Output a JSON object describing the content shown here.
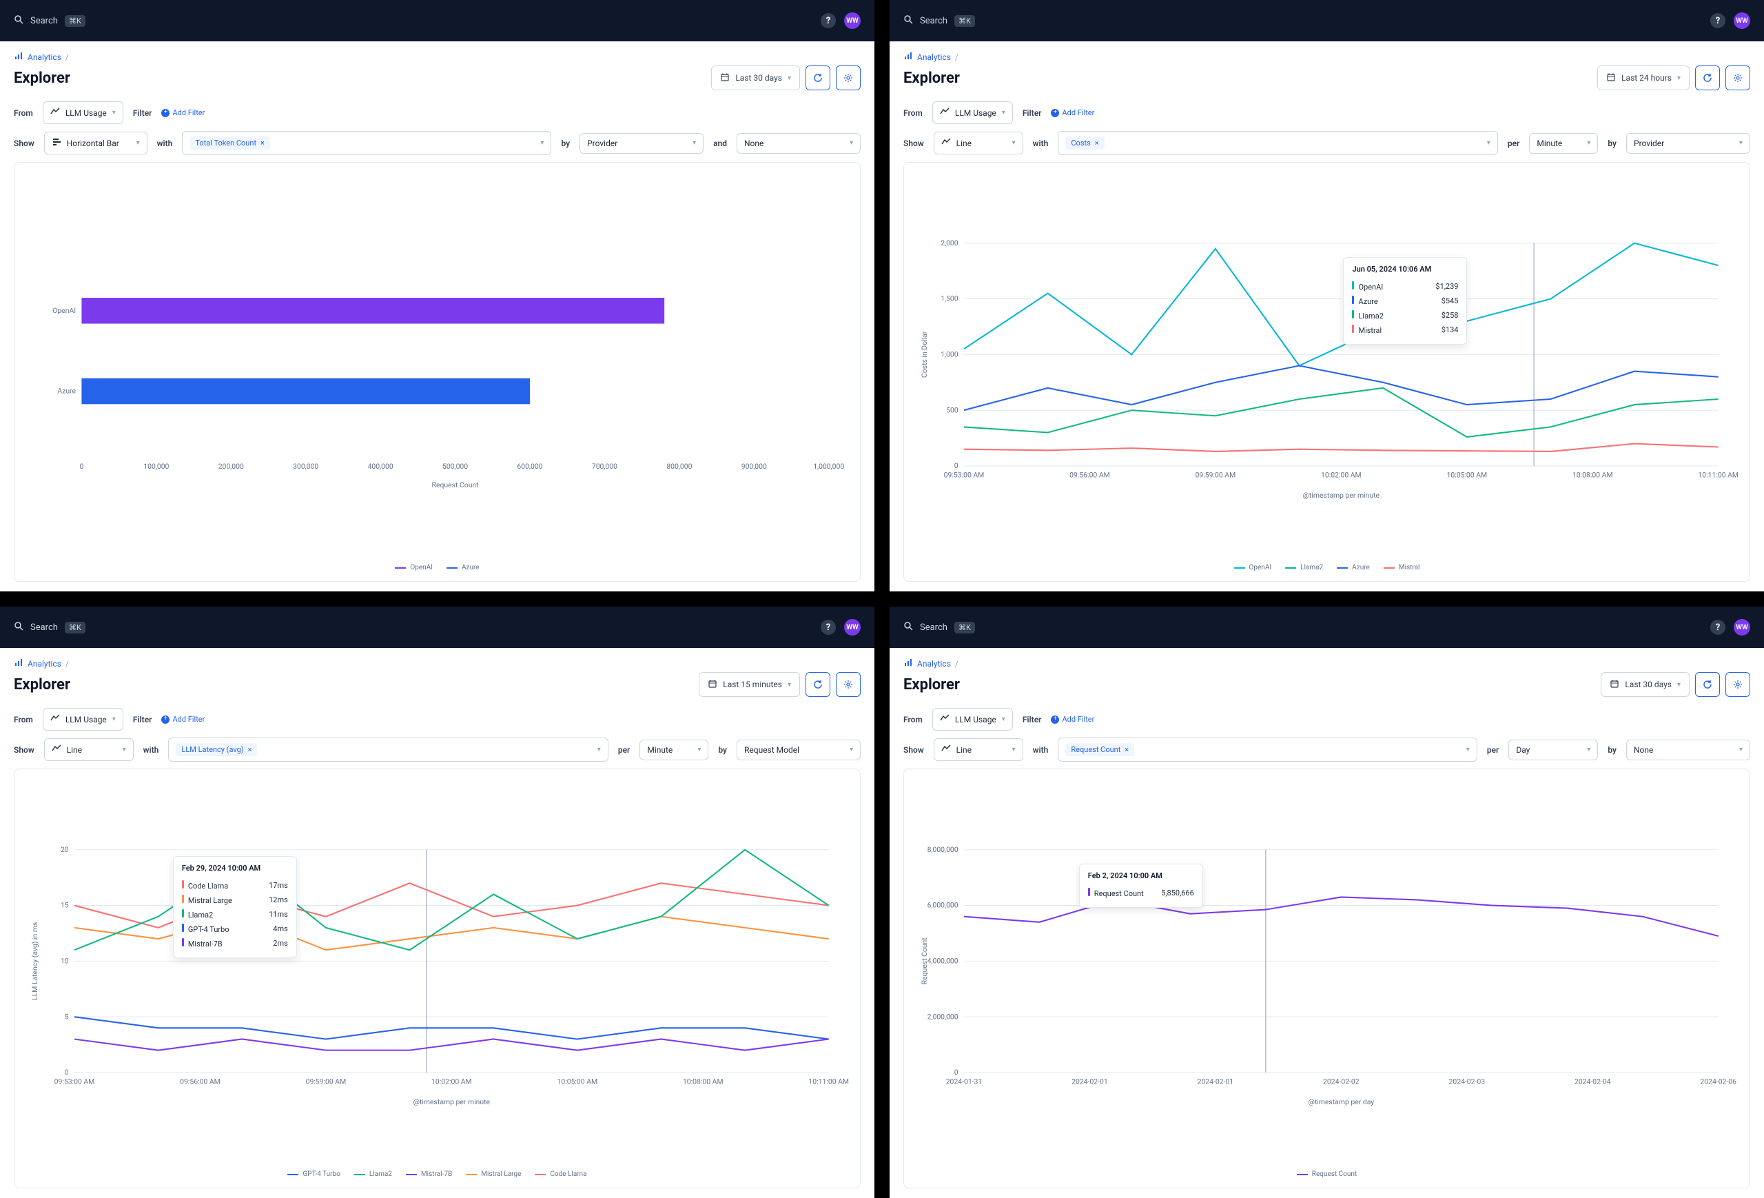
{
  "common": {
    "searchLabel": "Search",
    "searchKbd": "⌘K",
    "avatarInitials": "WW",
    "breadcrumb": "Analytics",
    "pageTitle": "Explorer",
    "fromLabel": "From",
    "filterLabel": "Filter",
    "addFilter": "Add Filter",
    "showLabel": "Show",
    "withLabel": "with",
    "perLabel": "per",
    "byLabel": "by",
    "andLabel": "and",
    "llmUsage": "LLM Usage"
  },
  "panelA": {
    "timeRange": "Last 30 days",
    "chartType": "Horizontal Bar",
    "metric": "Total Token Count",
    "bySelect": "Provider",
    "andSelect": "None",
    "xAxisLabel": "Request Count",
    "legend": [
      {
        "name": "OpenAI",
        "color": "#7c3aed"
      },
      {
        "name": "Azure",
        "color": "#2563eb"
      }
    ]
  },
  "panelB": {
    "timeRange": "Last 24 hours",
    "chartType": "Line",
    "metric": "Costs",
    "perSelect": "Minute",
    "bySelect": "Provider",
    "yAxisLabel": "Costs in Dollar",
    "xAxisLabel": "@timestamp per minute",
    "tooltip": {
      "title": "Jun 05, 2024 10:06 AM",
      "rows": [
        {
          "name": "OpenAI",
          "value": "$1,239",
          "color": "#06b6d4"
        },
        {
          "name": "Azure",
          "value": "$545",
          "color": "#2563eb"
        },
        {
          "name": "Llama2",
          "value": "$258",
          "color": "#10b981"
        },
        {
          "name": "Mistral",
          "value": "$134",
          "color": "#f87171"
        }
      ]
    },
    "legend": [
      {
        "name": "OpenAI",
        "color": "#06b6d4"
      },
      {
        "name": "Llama2",
        "color": "#10b981"
      },
      {
        "name": "Azure",
        "color": "#2563eb"
      },
      {
        "name": "Mistral",
        "color": "#f87171"
      }
    ]
  },
  "panelC": {
    "timeRange": "Last 15 minutes",
    "chartType": "Line",
    "metric": "LLM Latency (avg)",
    "perSelect": "Minute",
    "bySelect": "Request Model",
    "yAxisLabel": "LLM Latency (avg) in ms",
    "xAxisLabel": "@timestamp per minute",
    "tooltip": {
      "title": "Feb 29, 2024 10:00 AM",
      "rows": [
        {
          "name": "Code Llama",
          "value": "17ms",
          "color": "#f87171"
        },
        {
          "name": "Mistral Large",
          "value": "12ms",
          "color": "#fb923c"
        },
        {
          "name": "Llama2",
          "value": "11ms",
          "color": "#10b981"
        },
        {
          "name": "GPT-4 Turbo",
          "value": "4ms",
          "color": "#2563eb"
        },
        {
          "name": "Mistral-7B",
          "value": "2ms",
          "color": "#7c3aed"
        }
      ]
    },
    "legend": [
      {
        "name": "GPT-4 Turbo",
        "color": "#2563eb"
      },
      {
        "name": "Llama2",
        "color": "#10b981"
      },
      {
        "name": "Mistral-7B",
        "color": "#7c3aed"
      },
      {
        "name": "Mistral Large",
        "color": "#fb923c"
      },
      {
        "name": "Code Llama",
        "color": "#f87171"
      }
    ]
  },
  "panelD": {
    "timeRange": "Last 30 days",
    "chartType": "Line",
    "metric": "Request Count",
    "perSelect": "Day",
    "bySelect": "None",
    "yAxisLabel": "Request Count",
    "xAxisLabel": "@timestamp per day",
    "tooltip": {
      "title": "Feb 2, 2024 10:00 AM",
      "rows": [
        {
          "name": "Request Count",
          "value": "5,850,666",
          "color": "#7c3aed"
        }
      ]
    },
    "legend": [
      {
        "name": "Request Count",
        "color": "#7c3aed"
      }
    ]
  },
  "chart_data": [
    {
      "id": "panelA",
      "type": "bar",
      "orientation": "horizontal",
      "categories": [
        "OpenAI",
        "Azure"
      ],
      "values": [
        780000,
        600000
      ],
      "colors": [
        "#7c3aed",
        "#2563eb"
      ],
      "xlabel": "Request Count",
      "xlim": [
        0,
        1000000
      ],
      "xticks": [
        0,
        100000,
        200000,
        300000,
        400000,
        500000,
        600000,
        700000,
        800000,
        900000,
        1000000
      ]
    },
    {
      "id": "panelB",
      "type": "line",
      "title": "Costs in Dollar per minute",
      "ylabel": "Costs in Dollar",
      "xlabel": "@timestamp per minute",
      "ylim": [
        0,
        2000
      ],
      "yticks": [
        0,
        500,
        1000,
        1500,
        2000
      ],
      "x": [
        "09:53:00 AM",
        "09:56:00 AM",
        "09:59:00 AM",
        "10:02:00 AM",
        "10:05:00 AM",
        "10:08:00 AM",
        "10:11:00 AM"
      ],
      "series": [
        {
          "name": "OpenAI",
          "color": "#06b6d4",
          "values": [
            1050,
            1550,
            1000,
            1950,
            900,
            1250,
            1300,
            1500,
            2000,
            1800
          ]
        },
        {
          "name": "Azure",
          "color": "#2563eb",
          "values": [
            500,
            700,
            550,
            750,
            900,
            750,
            550,
            600,
            850,
            800
          ]
        },
        {
          "name": "Llama2",
          "color": "#10b981",
          "values": [
            350,
            300,
            500,
            450,
            600,
            700,
            260,
            350,
            550,
            600
          ]
        },
        {
          "name": "Mistral",
          "color": "#f87171",
          "values": [
            150,
            140,
            160,
            130,
            150,
            140,
            135,
            130,
            200,
            170
          ]
        }
      ],
      "tooltip_sample": {
        "time": "Jun 05, 2024 10:06 AM",
        "OpenAI": 1239,
        "Azure": 545,
        "Llama2": 258,
        "Mistral": 134
      }
    },
    {
      "id": "panelC",
      "type": "line",
      "ylabel": "LLM Latency (avg) in ms",
      "xlabel": "@timestamp per minute",
      "ylim": [
        0,
        20
      ],
      "yticks": [
        0,
        5,
        10,
        15,
        20
      ],
      "x": [
        "09:53:00 AM",
        "09:56:00 AM",
        "09:59:00 AM",
        "10:02:00 AM",
        "10:05:00 AM",
        "10:08:00 AM",
        "10:11:00 AM"
      ],
      "series": [
        {
          "name": "Code Llama",
          "color": "#f87171",
          "values": [
            15,
            13,
            16,
            14,
            17,
            14,
            15,
            17,
            16,
            15
          ]
        },
        {
          "name": "Mistral Large",
          "color": "#fb923c",
          "values": [
            13,
            12,
            14,
            11,
            12,
            13,
            12,
            14,
            13,
            12
          ]
        },
        {
          "name": "Llama2",
          "color": "#10b981",
          "values": [
            11,
            14,
            19,
            13,
            11,
            16,
            12,
            14,
            20,
            15
          ]
        },
        {
          "name": "GPT-4 Turbo",
          "color": "#2563eb",
          "values": [
            5,
            4,
            4,
            3,
            4,
            4,
            3,
            4,
            4,
            3
          ]
        },
        {
          "name": "Mistral-7B",
          "color": "#7c3aed",
          "values": [
            3,
            2,
            3,
            2,
            2,
            3,
            2,
            3,
            2,
            3
          ]
        }
      ],
      "tooltip_sample": {
        "time": "Feb 29, 2024 10:00 AM",
        "Code Llama": 17,
        "Mistral Large": 12,
        "Llama2": 11,
        "GPT-4 Turbo": 4,
        "Mistral-7B": 2
      }
    },
    {
      "id": "panelD",
      "type": "line",
      "ylabel": "Request Count",
      "xlabel": "@timestamp per day",
      "ylim": [
        0,
        8000000
      ],
      "yticks": [
        0,
        2000000,
        4000000,
        6000000,
        8000000
      ],
      "x": [
        "2024-01-31",
        "2024-02-01",
        "2024-02-01",
        "2024-02-02",
        "2024-02-03",
        "2024-02-04",
        "2024-02-06"
      ],
      "series": [
        {
          "name": "Request Count",
          "color": "#7c3aed",
          "values": [
            5600000,
            5400000,
            6200000,
            5700000,
            5850666,
            6300000,
            6200000,
            6000000,
            5900000,
            5600000,
            4900000
          ]
        }
      ],
      "tooltip_sample": {
        "time": "Feb 2, 2024 10:00 AM",
        "Request Count": 5850666
      }
    }
  ]
}
